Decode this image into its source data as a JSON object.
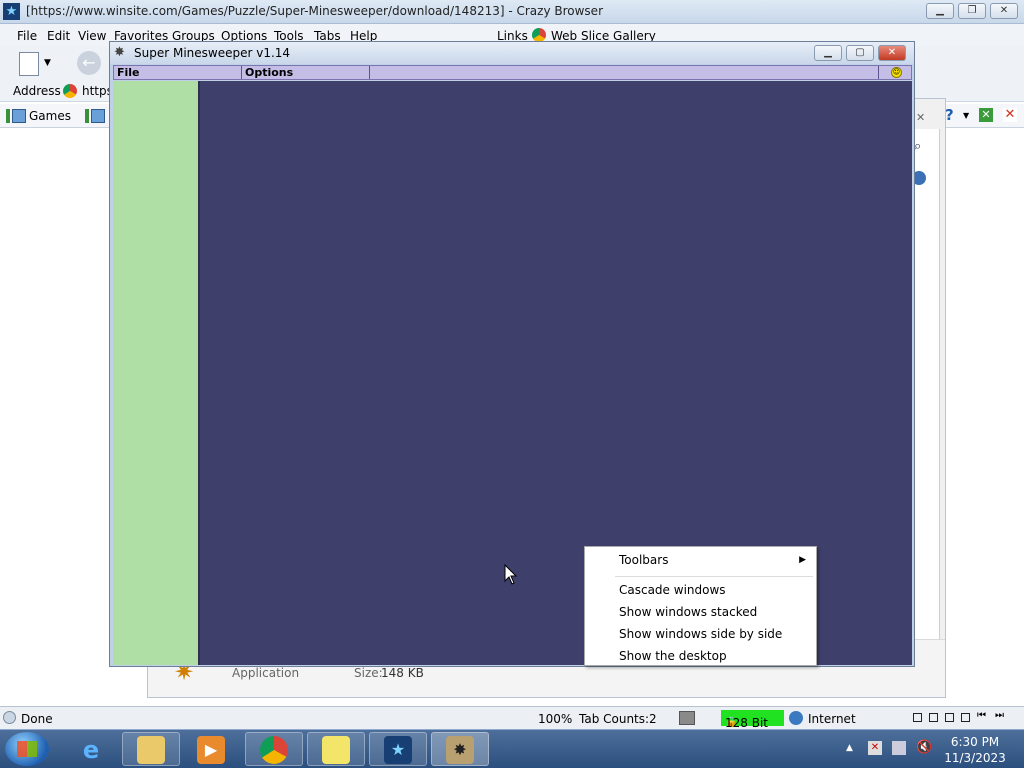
{
  "browser": {
    "title": "[https://www.winsite.com/Games/Puzzle/Super-Minesweeper/download/148213] - Crazy Browser",
    "menu": [
      "File",
      "Edit",
      "View",
      "Favorites",
      "Groups",
      "Options",
      "Tools",
      "Tabs",
      "Help"
    ],
    "links_label": "Links",
    "web_slice_label": "Web Slice Gallery",
    "address_label": "Address",
    "address_value": "https",
    "tab_label": "Games",
    "status": {
      "text": "Done",
      "zoom": "100%",
      "tab_counts": "Tab Counts:2",
      "encryption": "128 Bit",
      "zone": "Internet"
    },
    "page": {
      "file_type": "Application",
      "size_label": "Size:",
      "size_value": "148 KB"
    }
  },
  "minesweeper": {
    "title": "Super Minesweeper v1.14",
    "menu": [
      "File",
      "Options"
    ],
    "colors": {
      "sidebar": "#afdfa5",
      "board": "#3f3f6c",
      "menubar": "#c4bee7"
    }
  },
  "context_menu": {
    "items": [
      "Toolbars",
      "Cascade windows",
      "Show windows stacked",
      "Show windows side by side",
      "Show the desktop"
    ]
  },
  "taskbar": {
    "apps": [
      "internet-explorer",
      "file-explorer",
      "media-player",
      "chrome",
      "sticky-notes",
      "crazy-browser",
      "super-minesweeper"
    ],
    "time": "6:30 PM",
    "date": "11/3/2023"
  }
}
